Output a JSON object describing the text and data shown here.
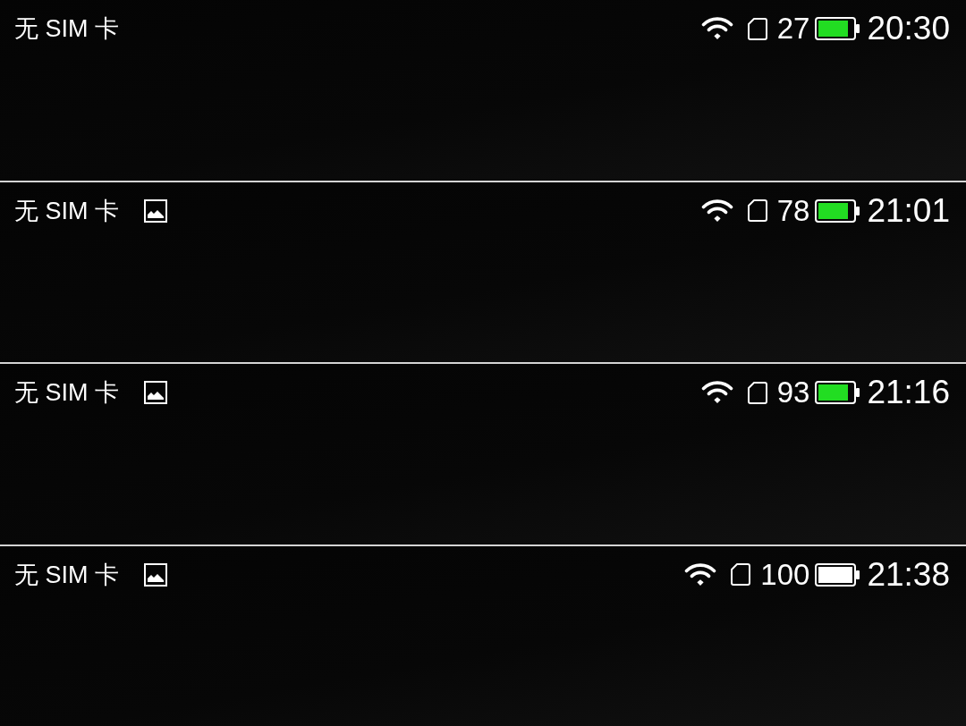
{
  "status_bars": [
    {
      "carrier": "无 SIM 卡",
      "image_notification": false,
      "battery_percent": "27",
      "charging": true,
      "time": "20:30"
    },
    {
      "carrier": "无 SIM 卡",
      "image_notification": true,
      "battery_percent": "78",
      "charging": true,
      "time": "21:01"
    },
    {
      "carrier": "无 SIM 卡",
      "image_notification": true,
      "battery_percent": "93",
      "charging": true,
      "time": "21:16"
    },
    {
      "carrier": "无 SIM 卡",
      "image_notification": true,
      "battery_percent": "100",
      "charging": false,
      "time": "21:38"
    }
  ]
}
